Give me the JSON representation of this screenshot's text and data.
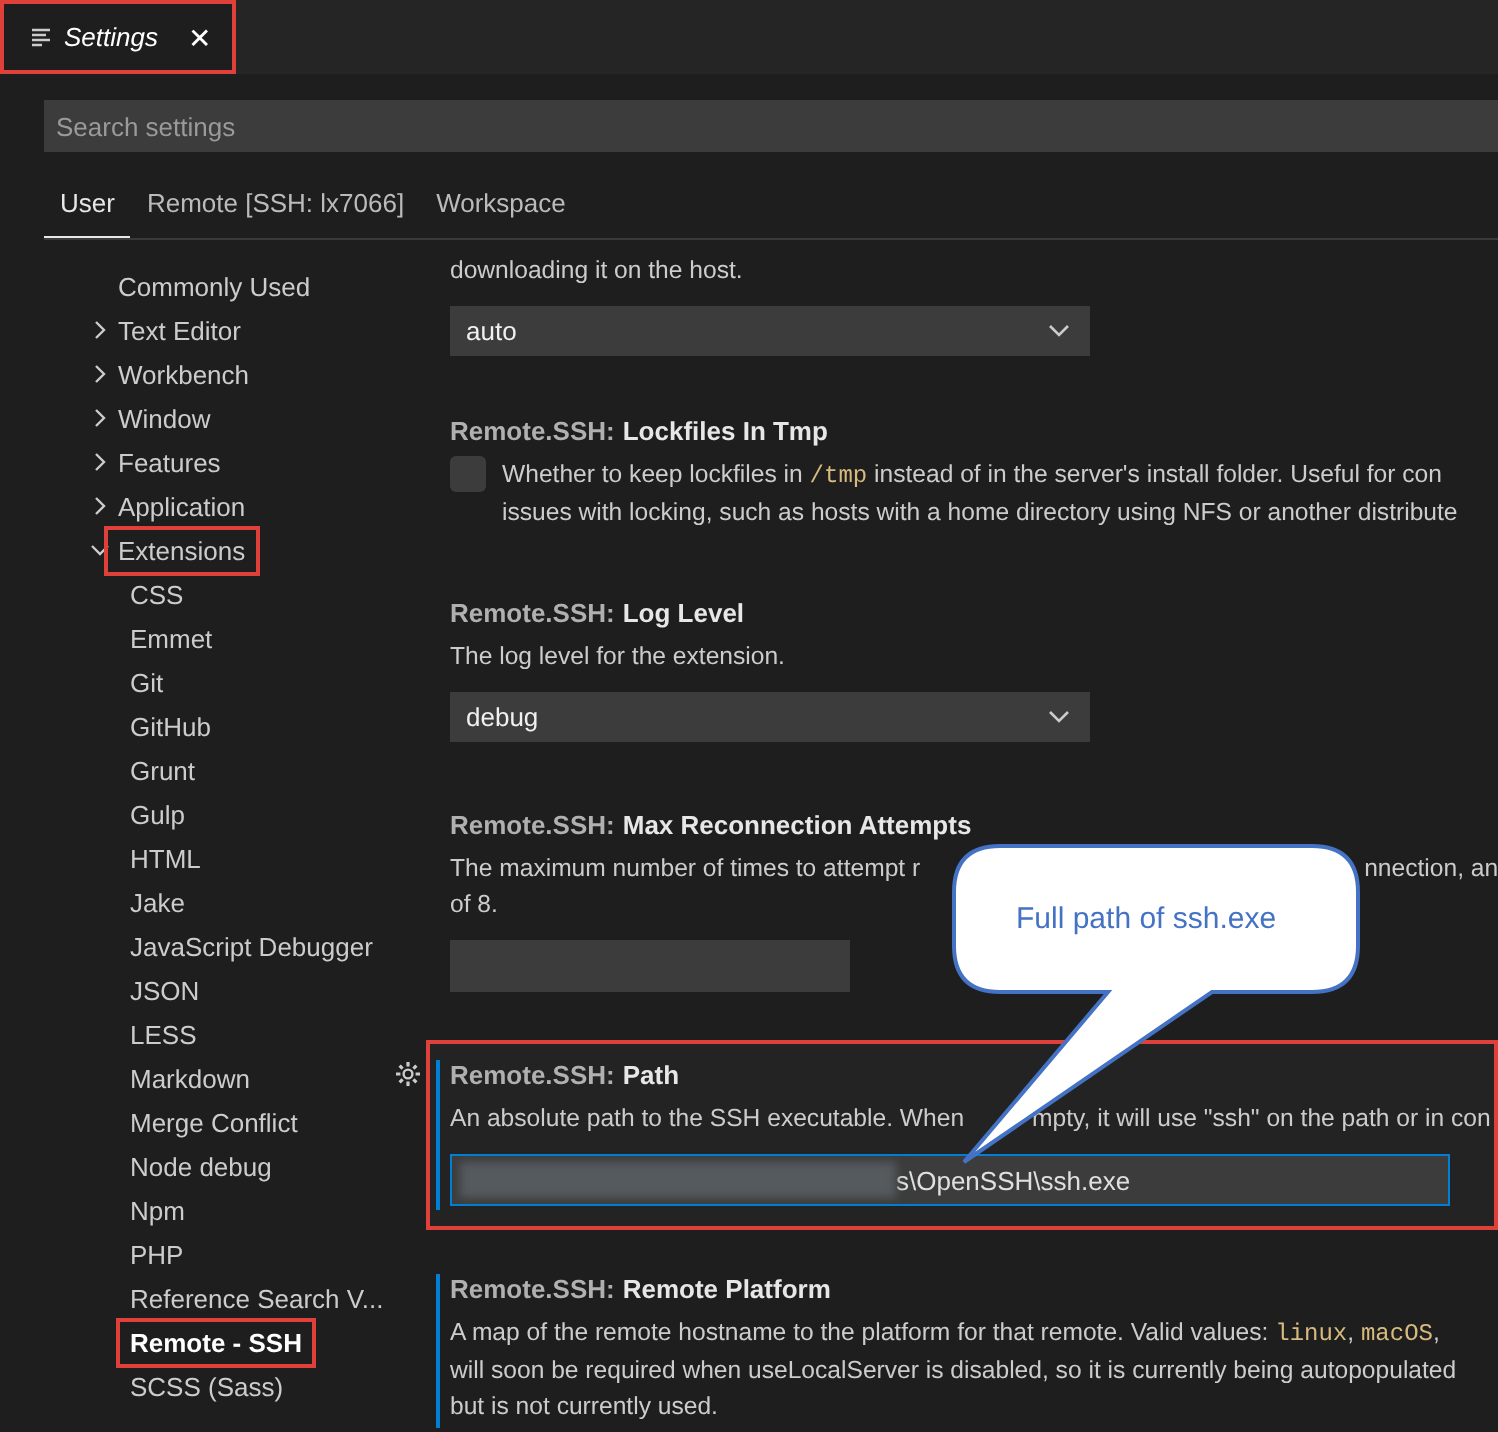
{
  "editor_tab": {
    "title": "Settings",
    "close": "✕",
    "highlighted": true
  },
  "search": {
    "placeholder": "Search settings"
  },
  "scope_tabs": [
    {
      "label": "User",
      "selected": true
    },
    {
      "label": "Remote [SSH: lx7066]",
      "selected": false
    },
    {
      "label": "Workspace",
      "selected": false
    }
  ],
  "toc": [
    {
      "label": "Commonly Used",
      "selected": false,
      "highlighted": false
    },
    {
      "label": "Text Editor",
      "expanded": false,
      "selected": false,
      "highlighted": false
    },
    {
      "label": "Workbench",
      "expanded": false,
      "selected": false,
      "highlighted": false
    },
    {
      "label": "Window",
      "expanded": false,
      "selected": false,
      "highlighted": false
    },
    {
      "label": "Features",
      "expanded": false,
      "selected": false,
      "highlighted": false
    },
    {
      "label": "Application",
      "expanded": false,
      "selected": false,
      "highlighted": false
    },
    {
      "label": "Extensions",
      "expanded": true,
      "selected": false,
      "highlighted": true,
      "children": [
        {
          "label": "CSS",
          "selected": false,
          "highlighted": false
        },
        {
          "label": "Emmet",
          "selected": false,
          "highlighted": false
        },
        {
          "label": "Git",
          "selected": false,
          "highlighted": false
        },
        {
          "label": "GitHub",
          "selected": false,
          "highlighted": false
        },
        {
          "label": "Grunt",
          "selected": false,
          "highlighted": false
        },
        {
          "label": "Gulp",
          "selected": false,
          "highlighted": false
        },
        {
          "label": "HTML",
          "selected": false,
          "highlighted": false
        },
        {
          "label": "Jake",
          "selected": false,
          "highlighted": false
        },
        {
          "label": "JavaScript Debugger",
          "selected": false,
          "highlighted": false
        },
        {
          "label": "JSON",
          "selected": false,
          "highlighted": false
        },
        {
          "label": "LESS",
          "selected": false,
          "highlighted": false
        },
        {
          "label": "Markdown",
          "selected": false,
          "highlighted": false
        },
        {
          "label": "Merge Conflict",
          "selected": false,
          "highlighted": false
        },
        {
          "label": "Node debug",
          "selected": false,
          "highlighted": false
        },
        {
          "label": "Npm",
          "selected": false,
          "highlighted": false
        },
        {
          "label": "PHP",
          "selected": false,
          "highlighted": false
        },
        {
          "label": "Reference Search V...",
          "selected": false,
          "highlighted": false
        },
        {
          "label": "Remote - SSH",
          "selected": true,
          "highlighted": true
        },
        {
          "label": "SCSS (Sass)",
          "selected": false,
          "highlighted": false
        }
      ]
    }
  ],
  "settings": [
    {
      "kind": "dropdown",
      "value": "auto",
      "accent": false,
      "highlighted": false,
      "lines": [
        [
          {
            "kind": "text",
            "text": "downloading it on the host."
          }
        ]
      ]
    },
    {
      "category": "Remote.SSH:",
      "name": "Lockfiles In Tmp",
      "kind": "checkbox",
      "checked": false,
      "accent": false,
      "highlighted": false,
      "lines": [
        [
          {
            "kind": "text",
            "text": "Whether to keep lockfiles in "
          },
          {
            "kind": "code",
            "text": "/tmp"
          },
          {
            "kind": "text",
            "text": " instead of in the server's install folder. Useful for con"
          }
        ],
        [
          {
            "kind": "text",
            "text": "issues with locking, such as hosts with a home directory using NFS or another distribute"
          }
        ]
      ]
    },
    {
      "category": "Remote.SSH:",
      "name": "Log Level",
      "kind": "dropdown",
      "value": "debug",
      "accent": false,
      "highlighted": false,
      "lines": [
        [
          {
            "kind": "text",
            "text": "The log level for the extension."
          }
        ]
      ]
    },
    {
      "category": "Remote.SSH:",
      "name": "Max Reconnection Attempts",
      "kind": "text",
      "accent": false,
      "highlighted": false,
      "lines": [
        [
          {
            "kind": "text",
            "text": "The maximum number of times to attempt r"
          },
          {
            "kind": "resume",
            "text": "nnection, an"
          }
        ],
        [
          {
            "kind": "text",
            "text": "of 8."
          }
        ]
      ]
    },
    {
      "category": "Remote.SSH:",
      "name": "Path",
      "kind": "text",
      "value": "s\\OpenSSH\\ssh.exe",
      "redacted": true,
      "focused": true,
      "accent": true,
      "highlighted": true,
      "lines": [
        [
          {
            "kind": "text",
            "text": "An absolute path to the SSH executable. When"
          },
          {
            "kind": "resume_short",
            "text": "mpty, it will use \"ssh\" on the path or in con"
          }
        ]
      ]
    },
    {
      "category": "Remote.SSH:",
      "name": "Remote Platform",
      "kind": "info",
      "accent": true,
      "highlighted": false,
      "lines": [
        [
          {
            "kind": "text",
            "text": "A map of the remote hostname to the platform for that remote. Valid values: "
          },
          {
            "kind": "code",
            "text": "linux"
          },
          {
            "kind": "text",
            "text": ", "
          },
          {
            "kind": "code",
            "text": "macOS"
          },
          {
            "kind": "text",
            "text": ","
          }
        ],
        [
          {
            "kind": "text",
            "text": "will soon be required when useLocalServer is disabled, so it is currently being autopopulated"
          }
        ],
        [
          {
            "kind": "text",
            "text": "but is not currently used."
          }
        ]
      ]
    }
  ],
  "callout": {
    "text": "Full path of ssh.exe"
  }
}
